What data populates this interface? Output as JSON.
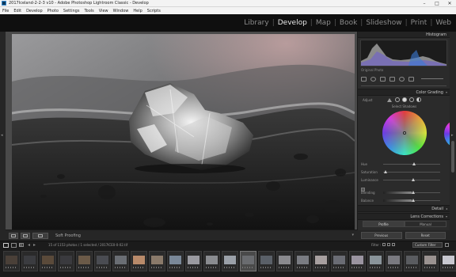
{
  "window": {
    "title": "2017Iceland-2-2-3 v10 - Adobe Photoshop Lightroom Classic - Develop",
    "controls": [
      "–",
      "□",
      "✕"
    ]
  },
  "menu": [
    "File",
    "Edit",
    "Develop",
    "Photo",
    "Settings",
    "Tools",
    "View",
    "Window",
    "Help",
    "Scripts"
  ],
  "modules": {
    "items": [
      "Library",
      "Develop",
      "Map",
      "Book",
      "Slideshow",
      "Print",
      "Web"
    ],
    "active": "Develop"
  },
  "toolbar": {
    "soft_proofing": "Soft Proofing"
  },
  "right_panel": {
    "histogram_label": "Histogram",
    "original_photo": "Original Photo",
    "color_grading_label": "Color Grading",
    "adjust_label": "Adjust",
    "wheel_label": "Select Shadows",
    "sliders": [
      {
        "label": "Hue",
        "value": 0.51
      },
      {
        "label": "Saturation",
        "value": 0.02
      },
      {
        "label": "Luminance",
        "value": 0.5
      }
    ],
    "blending": {
      "label": "Blending",
      "value": 0.5
    },
    "balance": {
      "label": "Balance",
      "value": 0.5
    },
    "detail_label": "Detail",
    "lens_label": "Lens Corrections",
    "lens_tabs": [
      "Profile",
      "Manual"
    ],
    "previous_label": "Previous",
    "reset_label": "Reset"
  },
  "filmstrip": {
    "catalog_info": "15 of 1153 photos / 1 selected / 2017ICE0-0-02.tif",
    "filter_label": "Filter :",
    "custom_filter": "Custom Filter",
    "thumbs": [
      {
        "color": "#4a4038"
      },
      {
        "color": "#3b3c40"
      },
      {
        "color": "#5a4a3a"
      },
      {
        "color": "#3a3a3e"
      },
      {
        "color": "#6b5a48"
      },
      {
        "color": "#4a4c52"
      },
      {
        "color": "#6a6e74"
      },
      {
        "color": "#b88a6a"
      },
      {
        "color": "#8a7a6a"
      },
      {
        "color": "#7a8898"
      },
      {
        "color": "#9a9aa0"
      },
      {
        "color": "#8a8c90"
      },
      {
        "color": "#9aa0a8"
      },
      {
        "color": "#6a6c70"
      },
      {
        "color": "#5a6068"
      },
      {
        "color": "#8a8a8e"
      },
      {
        "color": "#7a7c82"
      },
      {
        "color": "#a8a0a0"
      },
      {
        "color": "#6a6c74"
      },
      {
        "color": "#9a94a0"
      },
      {
        "color": "#8a949a"
      },
      {
        "color": "#7a7a80"
      },
      {
        "color": "#5a5c60"
      },
      {
        "color": "#9a9290"
      },
      {
        "color": "#c8c8d0"
      }
    ]
  },
  "colors": {
    "panel_bg": "#2b2b2b",
    "module_active": "#e8e8e8",
    "module_inactive": "#8c8c8c"
  }
}
